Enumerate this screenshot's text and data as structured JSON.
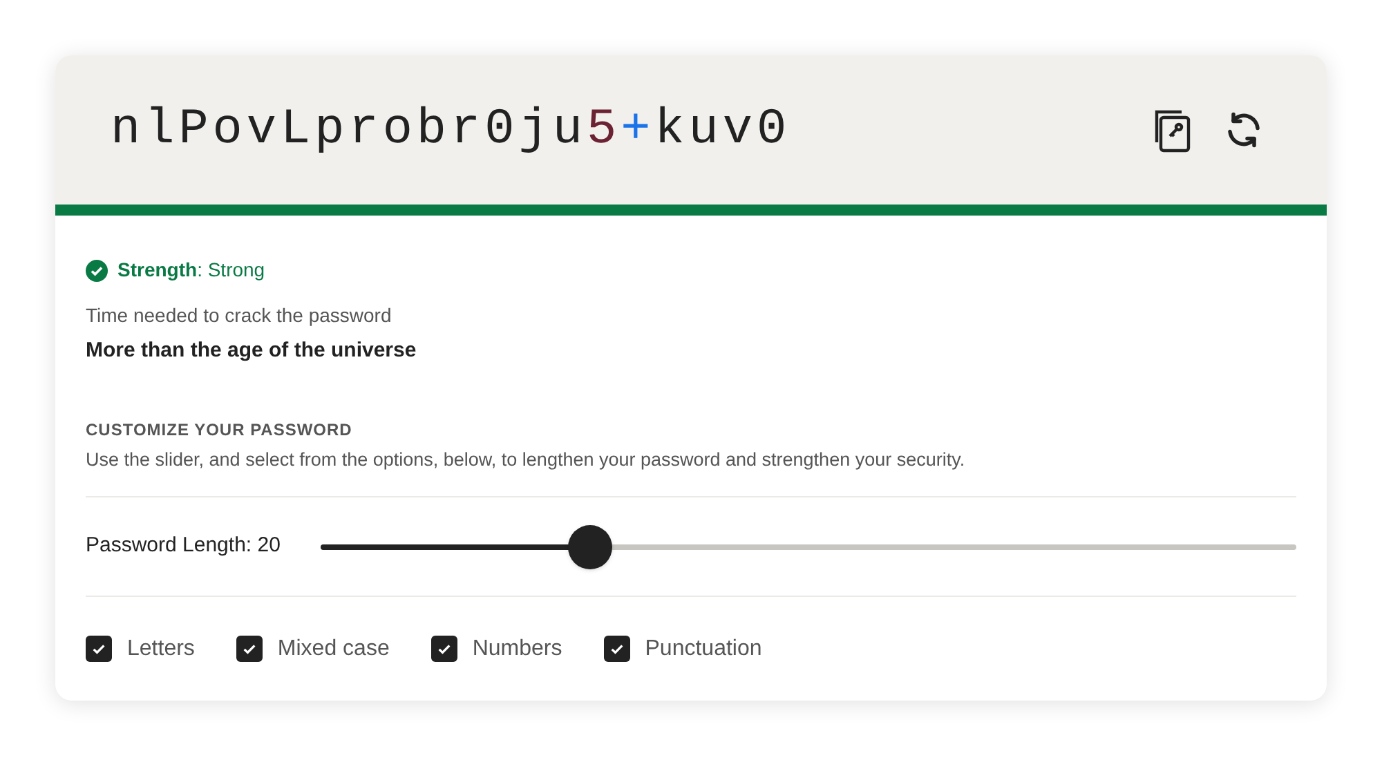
{
  "password": {
    "segments": [
      {
        "text": "nlPovLprobr0ju",
        "kind": "letter"
      },
      {
        "text": "5",
        "kind": "digit"
      },
      {
        "text": "+",
        "kind": "symbol"
      },
      {
        "text": "kuv0",
        "kind": "letter"
      }
    ]
  },
  "strength": {
    "text": "**Strength**: Strong",
    "level": 1
  },
  "crack_time": {
    "label": "Time needed to crack the password",
    "value": "More than the age of the universe"
  },
  "customize": {
    "heading": "CUSTOMIZE YOUR PASSWORD",
    "description": "Use the slider, and select from the options, below, to lengthen your password and strengthen your security."
  },
  "length": {
    "label": "Password Length: 20",
    "level": 0.276
  },
  "options": [
    {
      "label": "Letters",
      "checked": true
    },
    {
      "label": "Mixed case",
      "checked": true
    },
    {
      "label": "Numbers",
      "checked": true
    },
    {
      "label": "Punctuation",
      "checked": true
    }
  ]
}
